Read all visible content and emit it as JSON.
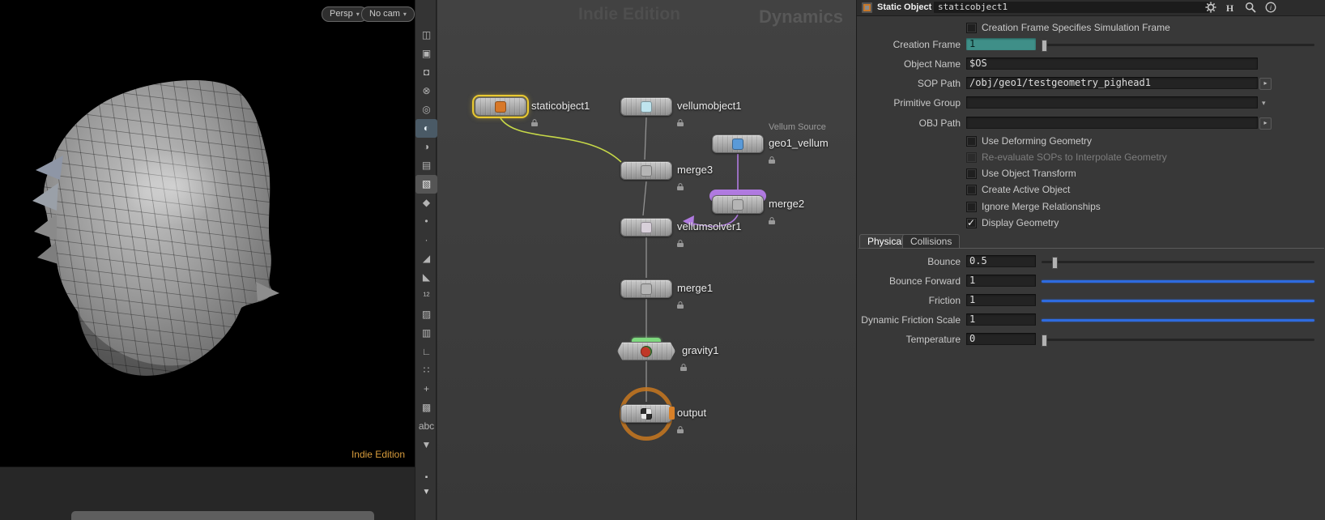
{
  "viewport": {
    "persp_button": "Persp",
    "cam_button": "No cam",
    "watermark": "Indie Edition"
  },
  "network": {
    "watermark": "Indie Edition",
    "context_label": "Dynamics",
    "nodes": [
      {
        "label": "staticobject1",
        "selected": true
      },
      {
        "label": "vellumobject1"
      },
      {
        "label": "geo1_vellum",
        "note": "Vellum Source"
      },
      {
        "label": "merge3"
      },
      {
        "label": "merge2"
      },
      {
        "label": "vellumsolver1"
      },
      {
        "label": "merge1"
      },
      {
        "label": "gravity1"
      },
      {
        "label": "output"
      }
    ],
    "colors": {
      "selection_outline": "#e8c832",
      "wire_yellow": "#c6d848",
      "wire_purple": "#b07ae0",
      "wire_gray": "#929292",
      "output_ring": "#c87820",
      "merge2_band": "#b07ae0",
      "gravity_cap": "#7ed87e"
    }
  },
  "toolbar": {
    "icons": [
      {
        "name": "pane-layout-icon",
        "glyph": "◫"
      },
      {
        "name": "snapshot-icon",
        "glyph": "▣"
      },
      {
        "name": "lock-icon",
        "glyph": "◘"
      },
      {
        "name": "no-select-icon",
        "glyph": "⊗"
      },
      {
        "name": "view-mode-icon",
        "glyph": "◎"
      },
      {
        "name": "lightbulb-icon",
        "glyph": "◐",
        "active": true
      },
      {
        "name": "lightbulb-alt-icon",
        "glyph": "◑"
      },
      {
        "name": "camera-icon",
        "glyph": "▤"
      },
      {
        "name": "object-select-icon",
        "glyph": "▧",
        "active2": true
      },
      {
        "name": "brush-icon",
        "glyph": "◆"
      },
      {
        "name": "point-icon",
        "glyph": "•"
      },
      {
        "name": "small-point-icon",
        "glyph": "·"
      },
      {
        "name": "pencil-icon",
        "glyph": "◢"
      },
      {
        "name": "pen-icon",
        "glyph": "◣"
      },
      {
        "name": "digits-icon",
        "glyph": "¹²"
      },
      {
        "name": "paint-icon",
        "glyph": "▨"
      },
      {
        "name": "stamp-icon",
        "glyph": "▥"
      },
      {
        "name": "ruler-icon",
        "glyph": "∟"
      },
      {
        "name": "dots-grid-icon",
        "glyph": "∷"
      },
      {
        "name": "wrench-icon",
        "glyph": "+"
      },
      {
        "name": "layers-icon",
        "glyph": "▩"
      },
      {
        "name": "abc-icon",
        "glyph": "abc"
      },
      {
        "name": "expand-chevron-icon",
        "glyph": "▼"
      }
    ]
  },
  "params": {
    "header": {
      "type_label": "Static Object",
      "node_name": "staticobject1"
    },
    "creation_frame_spec": {
      "label": "Creation Frame Specifies Simulation Frame",
      "checked": false
    },
    "creation_frame": {
      "label": "Creation Frame",
      "value": "1"
    },
    "object_name": {
      "label": "Object Name",
      "value": "$OS"
    },
    "sop_path": {
      "label": "SOP Path",
      "value": "/obj/geo1/testgeometry_pighead1"
    },
    "primitive_group": {
      "label": "Primitive Group",
      "value": ""
    },
    "obj_path": {
      "label": "OBJ Path",
      "value": ""
    },
    "toggles": [
      {
        "label": "Use Deforming Geometry",
        "checked": false
      },
      {
        "label": "Re-evaluate SOPs to Interpolate Geometry",
        "checked": false,
        "disabled": true
      },
      {
        "label": "Use Object Transform",
        "checked": false
      },
      {
        "label": "Create Active Object",
        "checked": false
      },
      {
        "label": "Ignore Merge Relationships",
        "checked": false
      },
      {
        "label": "Display Geometry",
        "checked": true
      }
    ],
    "tabs": [
      {
        "label": "Physical",
        "active": true
      },
      {
        "label": "Collisions",
        "active": false
      }
    ],
    "sliders": [
      {
        "label": "Bounce",
        "value": "0.5",
        "style": "handle",
        "pos": 0.04
      },
      {
        "label": "Bounce Forward",
        "value": "1",
        "style": "full-blue"
      },
      {
        "label": "Friction",
        "value": "1",
        "style": "full-blue"
      },
      {
        "label": "Dynamic Friction Scale",
        "value": "1",
        "style": "full-blue"
      },
      {
        "label": "Temperature",
        "value": "0",
        "style": "handle",
        "pos": 0.0
      }
    ],
    "colors": {
      "field_highlight": "#3f8f88",
      "slider_blue": "#2e6be0"
    }
  }
}
